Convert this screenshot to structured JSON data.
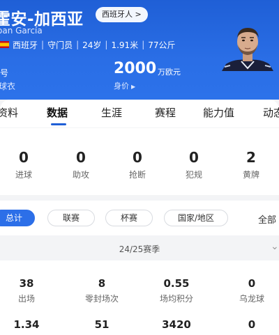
{
  "header": {
    "name_cn": "霍安-加西亚",
    "nationality_chip": "西班牙人 >",
    "name_en": "oan García",
    "nationality": "西班牙",
    "position": "守门员",
    "age": "24岁",
    "height": "1.91米",
    "weight": "77公斤",
    "left_label_1": "号",
    "left_label_2": "球衣",
    "value": "2000",
    "value_unit": "万欧元",
    "value_label": "身价"
  },
  "tabs": [
    "资料",
    "数据",
    "生涯",
    "赛程",
    "能力值",
    "动态"
  ],
  "active_tab": "数据",
  "summary": [
    {
      "value": "0",
      "label": "进球"
    },
    {
      "value": "0",
      "label": "助攻"
    },
    {
      "value": "0",
      "label": "抢断"
    },
    {
      "value": "0",
      "label": "犯规"
    },
    {
      "value": "2",
      "label": "黄牌"
    }
  ],
  "filters": [
    "总计",
    "联赛",
    "杯赛",
    "国家/地区"
  ],
  "filter_all": "全部",
  "season": "24/25赛季",
  "details_row1": [
    {
      "value": "38",
      "label": "出场"
    },
    {
      "value": "8",
      "label": "零封场次"
    },
    {
      "value": "0.55",
      "label": "场均积分"
    },
    {
      "value": "0",
      "label": "乌龙球"
    }
  ],
  "details_row2": [
    {
      "value": "1.34",
      "label": ""
    },
    {
      "value": "51",
      "label": ""
    },
    {
      "value": "3420",
      "label": ""
    },
    {
      "value": "0",
      "label": ""
    }
  ],
  "colors": {
    "accent": "#2c6fe8",
    "header_bg": "#1f5fd6"
  }
}
